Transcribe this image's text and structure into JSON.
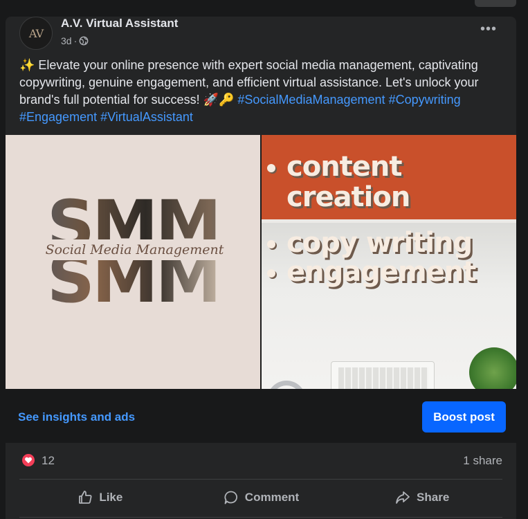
{
  "post": {
    "author": "A.V. Virtual Assistant",
    "avatar_text": "AV",
    "timestamp": "3d",
    "privacy_icon": "globe-icon",
    "more_icon": "more-horizontal-icon",
    "more_label": "•••",
    "text_intro": "✨ Elevate your online presence with expert social media management, captivating copywriting, genuine engagement, and efficient virtual assistance. Let's unlock your brand's full potential for success! 🚀🔑 ",
    "hashtags": [
      "#SocialMediaManagement",
      "#Copywriting",
      "#Engagement",
      "#VirtualAssistant"
    ]
  },
  "media": {
    "left_image": {
      "big_letters": "SMM",
      "label": "Social Media Management"
    },
    "right_image": {
      "lines": [
        "content",
        "creation",
        "copy writing",
        "engagement"
      ]
    }
  },
  "insights": {
    "link_label": "See insights and ads",
    "boost_label": "Boost post"
  },
  "stats": {
    "reaction_icon": "heart-icon",
    "reaction_count": "12",
    "share_count": "1 share"
  },
  "actions": [
    {
      "label": "Like",
      "icon": "thumbs-up-icon"
    },
    {
      "label": "Comment",
      "icon": "comment-icon"
    },
    {
      "label": "Share",
      "icon": "share-arrow-icon"
    }
  ],
  "colors": {
    "background": "#18191a",
    "card": "#242526",
    "link": "#4599ff",
    "boost": "#0866ff",
    "reaction": "#f33e58",
    "banner": "#c9502b"
  }
}
